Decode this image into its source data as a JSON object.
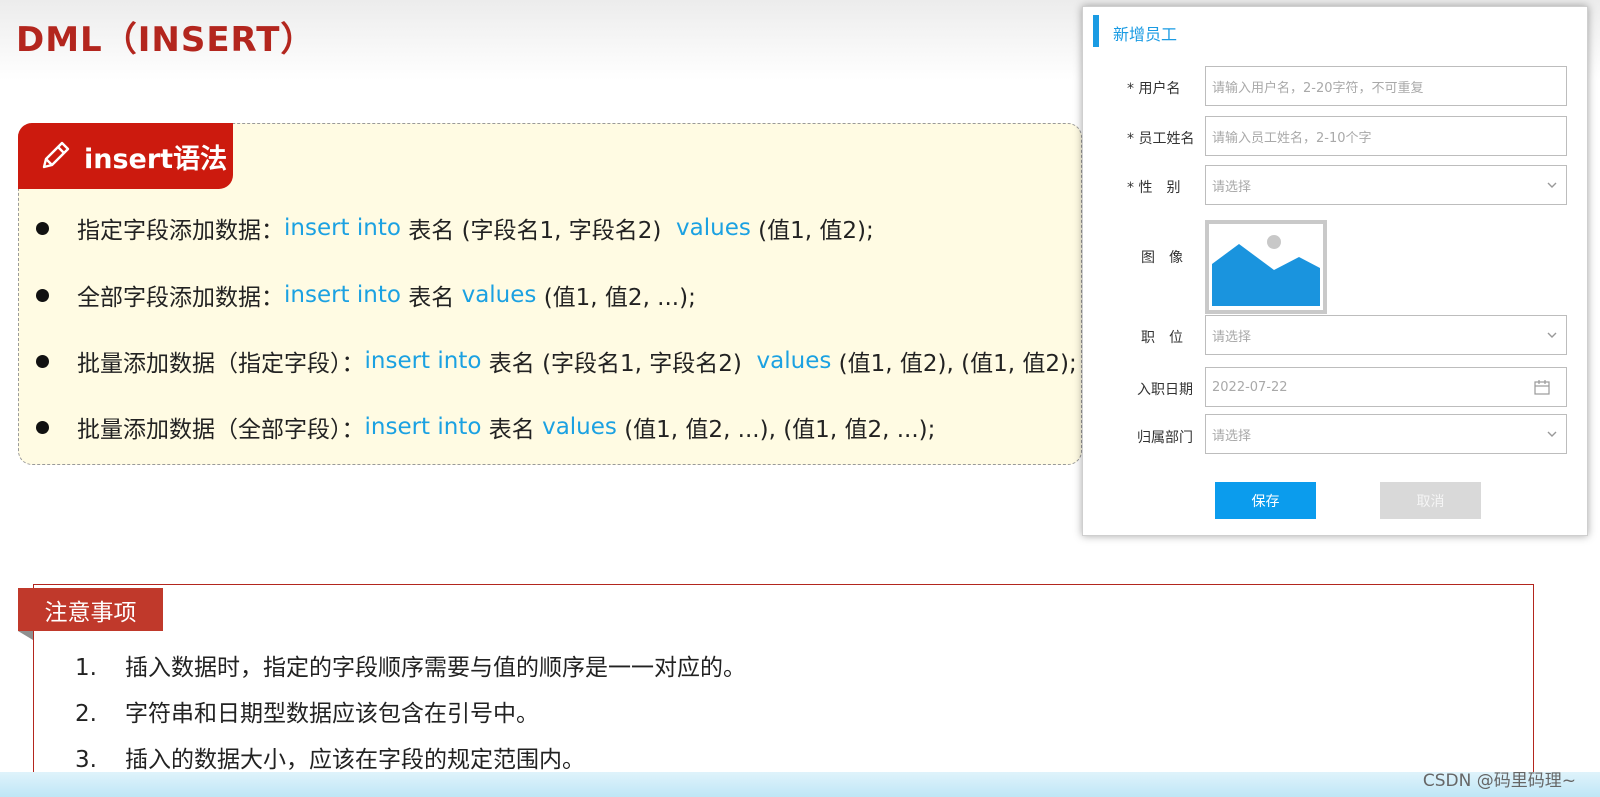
{
  "page_title": "DML（INSERT）",
  "syntax_box": {
    "tab_label": "insert语法",
    "rows": [
      {
        "label": "指定字段添加数据：",
        "segments": [
          "insert into",
          " 表名 (字段名1, 字段名2)  ",
          "values",
          " (值1, 值2);"
        ]
      },
      {
        "label": "全部字段添加数据：",
        "segments": [
          "insert into",
          " 表名 ",
          "values",
          " (值1, 值2, ...);"
        ]
      },
      {
        "label": "批量添加数据（指定字段）：",
        "segments": [
          "insert into",
          " 表名 (字段名1, 字段名2)  ",
          "values",
          " (值1, 值2), (值1, 值2);"
        ]
      },
      {
        "label": "批量添加数据（全部字段）：",
        "segments": [
          "insert into",
          " 表名 ",
          "values",
          " (值1, 值2, ...), (值1, 值2, ...);"
        ]
      }
    ]
  },
  "dialog": {
    "title": "新增员工",
    "username": {
      "label": "* 用户名",
      "placeholder": "请输入用户名，2-20字符，不可重复"
    },
    "fullname": {
      "label": "* 员工姓名",
      "placeholder": "请输入员工姓名，2-10个字"
    },
    "gender": {
      "label": "* 性　别",
      "placeholder": "请选择"
    },
    "image": {
      "label": "图　像"
    },
    "position": {
      "label": "职　位",
      "placeholder": "请选择"
    },
    "entry_date": {
      "label": "入职日期",
      "value": "2022-07-22"
    },
    "department": {
      "label": "归属部门",
      "placeholder": "请选择"
    },
    "save_label": "保存",
    "cancel_label": "取消"
  },
  "notes": {
    "tab_label": "注意事项",
    "items": [
      {
        "num": "1.",
        "text": "插入数据时，指定的字段顺序需要与值的顺序是一一对应的。"
      },
      {
        "num": "2.",
        "text": "字符串和日期型数据应该包含在引号中。"
      },
      {
        "num": "3.",
        "text": "插入的数据大小，应该在字段的规定范围内。"
      }
    ]
  },
  "watermark": "CSDN @码里码理~",
  "colors": {
    "title_red": "#b3261e",
    "tab_red": "#cc1a0e",
    "keyword_blue": "#1ba1e2",
    "dialog_blue": "#1a9be3",
    "save_button": "#0b9ced",
    "cancel_button": "#d9d9d9",
    "syntax_bg": "#fffbe3"
  }
}
